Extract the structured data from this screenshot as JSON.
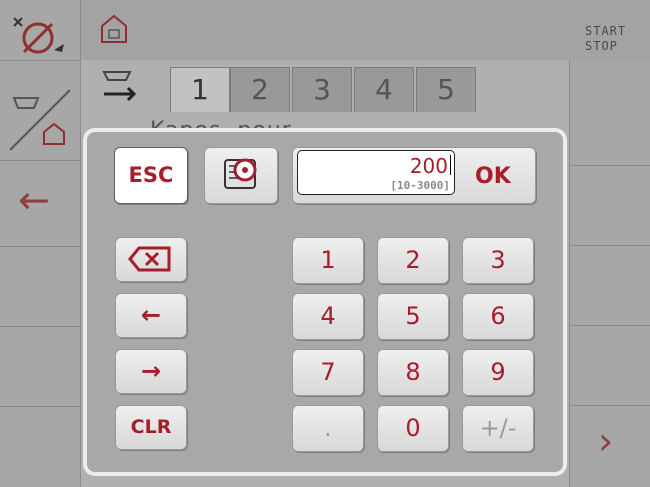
{
  "header": {
    "start_stop_line1": "START",
    "start_stop_line2": "STOP"
  },
  "tabs": [
    {
      "label": "1",
      "active": true
    },
    {
      "label": "2",
      "active": false
    },
    {
      "label": "3",
      "active": false
    },
    {
      "label": "4",
      "active": false
    },
    {
      "label": "5",
      "active": false
    }
  ],
  "background_text": "Kapos, pour",
  "dialog": {
    "esc_label": "ESC",
    "ok_label": "OK",
    "value": "200",
    "range": "[10-3000]",
    "clr_label": "CLR",
    "keys": [
      "1",
      "2",
      "3",
      "4",
      "5",
      "6",
      "7",
      "8",
      "9",
      ".",
      "0",
      "+/-"
    ]
  },
  "colors": {
    "accent": "#a51e2a",
    "dialog_bg": "#a8a8a8",
    "disabled": "#9a9a9a"
  }
}
